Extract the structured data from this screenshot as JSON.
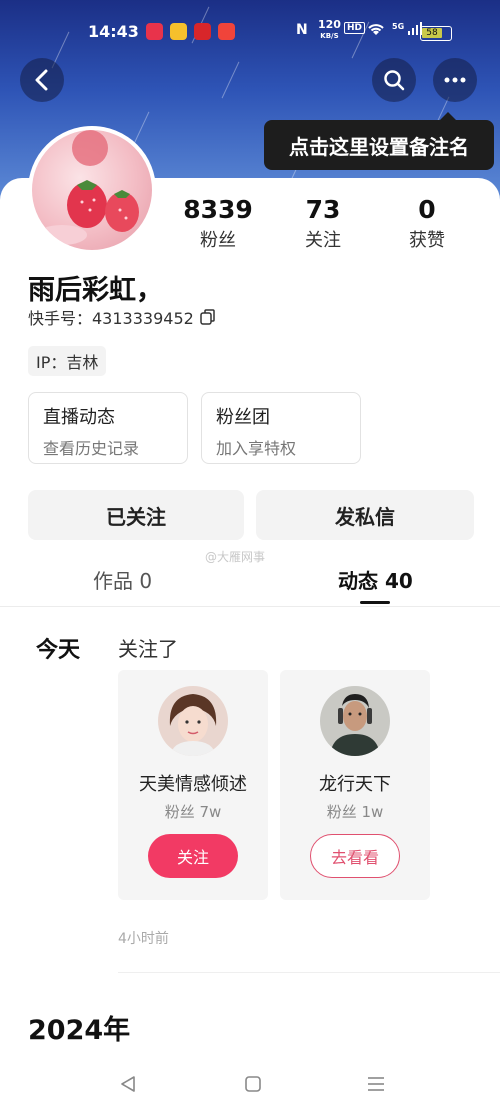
{
  "status_bar": {
    "time": "14:43",
    "network_speed_value": "120",
    "network_speed_unit": "KB/S",
    "hd_label": "HD",
    "signal_label": "5G",
    "battery_label": "58"
  },
  "profile": {
    "tooltip": "点击这里设置备注名",
    "username": "雨后彩虹，",
    "kuaishou_id": "快手号：4313339452",
    "ip": "IP：吉林",
    "stats": [
      {
        "value": "8339",
        "label": "粉丝"
      },
      {
        "value": "73",
        "label": "关注"
      },
      {
        "value": "0",
        "label": "获赞"
      }
    ],
    "info_boxes": [
      {
        "title": "直播动态",
        "subtitle": "查看历史记录"
      },
      {
        "title": "粉丝团",
        "subtitle": "加入享特权"
      }
    ],
    "actions": {
      "followed": "已关注",
      "message": "发私信"
    },
    "watermark": "@大雁网事"
  },
  "tabs": [
    {
      "label": "作品 0",
      "active": false
    },
    {
      "label": "动态 40",
      "active": true
    }
  ],
  "feed": {
    "date_label": "今天",
    "action_label": "关注了",
    "accounts": [
      {
        "name": "天美情感倾述",
        "fans": "粉丝 7w",
        "button": "关注",
        "button_style": "filled"
      },
      {
        "name": "龙行天下",
        "fans": "粉丝 1w",
        "button": "去看看",
        "button_style": "outline"
      }
    ],
    "time_ago": "4小时前",
    "year_label": "2024年"
  },
  "colors": {
    "accent": "#f23a64",
    "header_top": "#1b2f86",
    "header_bottom": "#5d8ad6"
  }
}
